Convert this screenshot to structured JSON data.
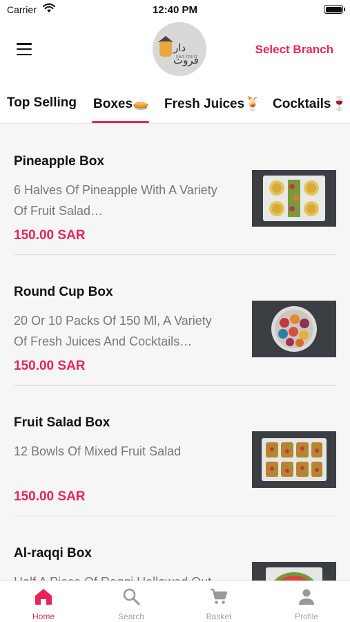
{
  "status_bar": {
    "carrier": "Carrier",
    "time": "12:40 PM"
  },
  "header": {
    "logo_text_ar": "دار فروت",
    "logo_text_en": "DAR FRUIT",
    "select_branch": "Select Branch"
  },
  "tabs": [
    {
      "label": "Top Selling"
    },
    {
      "label": "Boxes🥧"
    },
    {
      "label": "Fresh Juices🍹"
    },
    {
      "label": "Cocktails🍷"
    }
  ],
  "products": [
    {
      "title": "Pineapple Box",
      "desc1": "6 Halves Of Pineapple With A Variety",
      "desc2": "Of Fruit Salad…",
      "price": "150.00 SAR"
    },
    {
      "title": "Round Cup Box",
      "desc1": "20 Or 10 Packs Of 150 Ml, A Variety",
      "desc2": "Of Fresh Juices And Cocktails…",
      "price": "150.00 SAR"
    },
    {
      "title": "Fruit Salad Box",
      "desc1": "12 Bowls Of Mixed Fruit Salad",
      "desc2": "",
      "price": "150.00 SAR"
    },
    {
      "title": "Al-raqqi Box",
      "desc1": "Half A Piece Of Raqqi Hollowed Out",
      "desc2": "",
      "price": ""
    }
  ],
  "bottom_nav": [
    {
      "label": "Home",
      "icon": "home-icon"
    },
    {
      "label": "Search",
      "icon": "search-icon"
    },
    {
      "label": "Basket",
      "icon": "cart-icon"
    },
    {
      "label": "Profile",
      "icon": "person-icon"
    }
  ],
  "colors": {
    "accent": "#e8255a",
    "background": "#f6f6f6",
    "muted_text": "#777777"
  }
}
